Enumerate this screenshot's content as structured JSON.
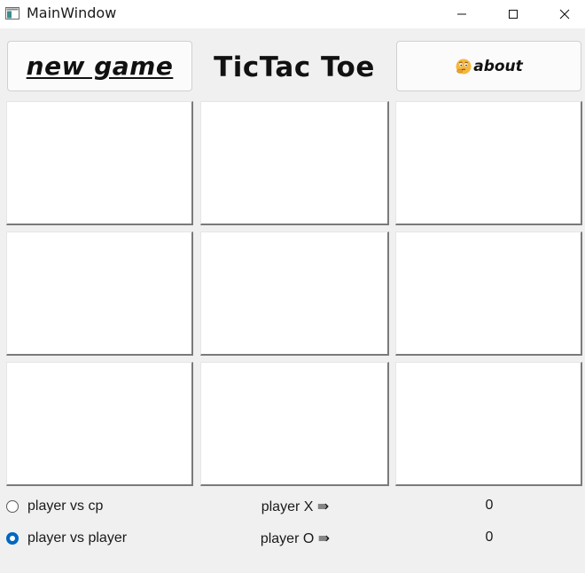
{
  "window": {
    "title": "MainWindow",
    "icon": "app-window-icon",
    "controls": [
      "minimize-icon",
      "maximize-icon",
      "close-icon"
    ]
  },
  "header": {
    "new_game_label": "new game",
    "title": "TicTac Toe",
    "about_label": "about",
    "about_icon": "thinking-face-emoji"
  },
  "board": {
    "cells": [
      "",
      "",
      "",
      "",
      "",
      "",
      "",
      "",
      ""
    ]
  },
  "modes": [
    {
      "label": "player vs cp",
      "checked": false
    },
    {
      "label": "player vs player",
      "checked": true
    }
  ],
  "players": [
    {
      "label": "player X ⇛",
      "score": "0"
    },
    {
      "label": "player O ⇛",
      "score": "0"
    }
  ],
  "colors": {
    "accent": "#0067c0",
    "background": "#f0f0f0",
    "cell": "#ffffff"
  }
}
